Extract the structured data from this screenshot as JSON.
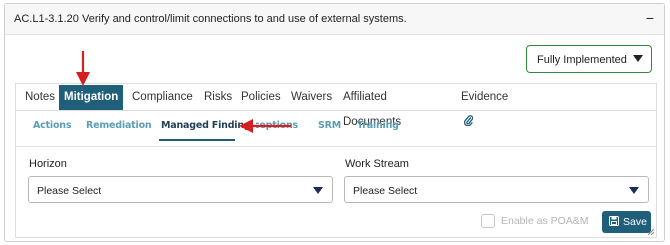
{
  "header": {
    "control_code": "AC.L1-3.1.20",
    "control_title": "Verify and control/limit connections to and use of external systems.",
    "collapse_symbol": "−"
  },
  "status": {
    "label": "Fully Implemented"
  },
  "tabs": [
    {
      "label": "Notes",
      "active": false
    },
    {
      "label": "Mitigation",
      "active": true
    },
    {
      "label": "Compliance",
      "active": false
    },
    {
      "label": "Risks",
      "active": false
    },
    {
      "label": "Policies",
      "active": false
    },
    {
      "label": "Waivers",
      "active": false
    },
    {
      "label": "Affiliated Documents",
      "active": false
    },
    {
      "label": "Evidence",
      "active": false,
      "icon": "paperclip-icon"
    }
  ],
  "subtabs": [
    {
      "label": "Actions",
      "active": false
    },
    {
      "label": "Remediation",
      "active": false
    },
    {
      "label": "Managed Finding",
      "active": true
    },
    {
      "label": "Exceptions",
      "active": false
    },
    {
      "label": "SRM",
      "active": false
    },
    {
      "label": "Training",
      "active": false
    }
  ],
  "form": {
    "horizon": {
      "label": "Horizon",
      "value": "Please Select"
    },
    "work_stream": {
      "label": "Work Stream",
      "value": "Please Select"
    },
    "enable_poam": {
      "label": "Enable as POA&M",
      "checked": false,
      "disabled": true
    },
    "save_label": "Save"
  },
  "colors": {
    "accent": "#1f5f7a",
    "status_border": "#2f8a3f",
    "annotation_arrow": "#d6201f",
    "subtab_inactive": "#5a9db5"
  }
}
